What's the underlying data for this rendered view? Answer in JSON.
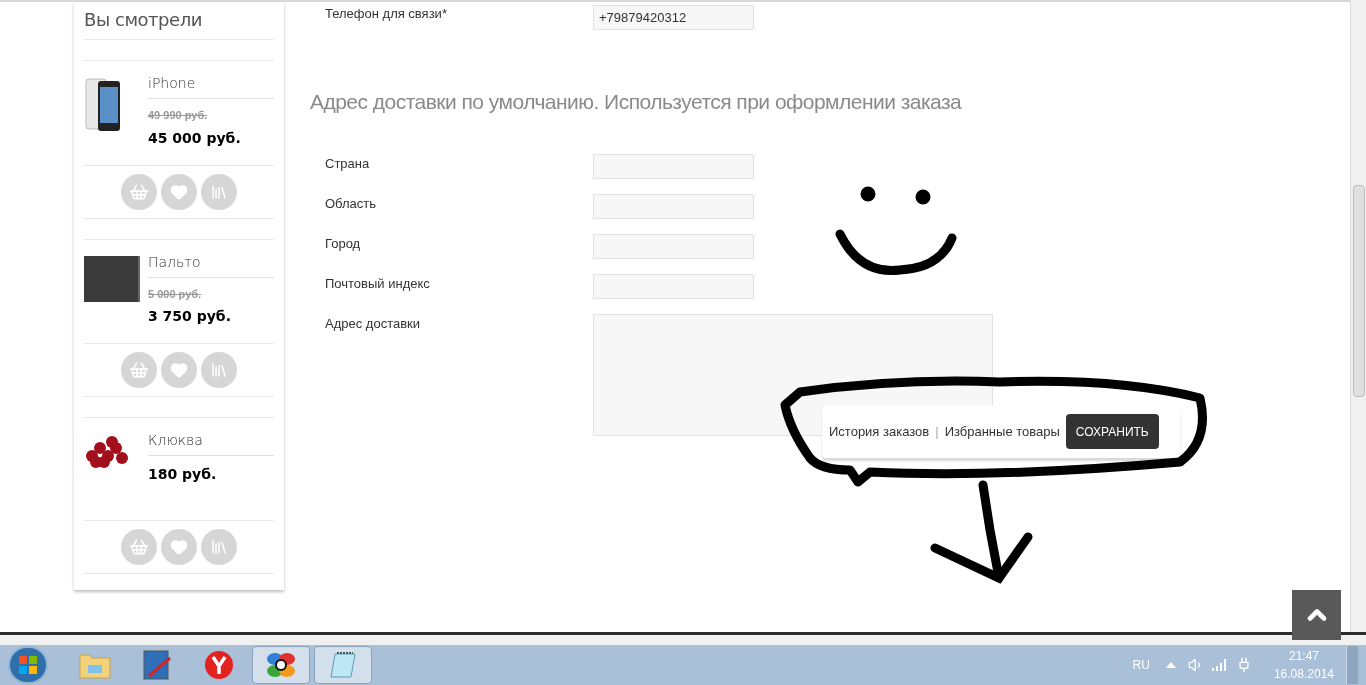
{
  "sidebar": {
    "title": "Вы смотрели",
    "products": [
      {
        "kind": "phone",
        "name": "iPhone",
        "old_price": "49 990 руб.",
        "price": "45 000 руб."
      },
      {
        "kind": "coat",
        "name": "Пальто",
        "old_price": "5 000 руб.",
        "price": "3 750 руб."
      },
      {
        "kind": "berries",
        "name": "Клюква",
        "price": "180 руб."
      }
    ]
  },
  "contact": {
    "label": "Телефон для связи*",
    "value": "+79879420312"
  },
  "address": {
    "heading": "Адрес доставки по умолчанию. Используется при оформлении заказа",
    "fields": [
      {
        "kind": "input",
        "label": "Страна"
      },
      {
        "kind": "input",
        "label": "Область"
      },
      {
        "kind": "input",
        "label": "Город"
      },
      {
        "kind": "input",
        "label": "Почтовый индекс"
      },
      {
        "kind": "textarea",
        "label": "Адрес доставки"
      }
    ]
  },
  "toolbar": {
    "links": [
      "История заказов",
      "Избранные товары"
    ],
    "separator": "|",
    "button": "СОХРАНИТЬ"
  },
  "taskbar": {
    "apps": [
      {
        "kind": "folder",
        "running": false
      },
      {
        "kind": "paint",
        "running": false
      },
      {
        "kind": "browser",
        "running": false
      },
      {
        "kind": "pinwheel",
        "running": true
      },
      {
        "kind": "notepad",
        "running": true
      }
    ],
    "language": "RU",
    "time": "21:47",
    "date": "16.08.2014"
  }
}
